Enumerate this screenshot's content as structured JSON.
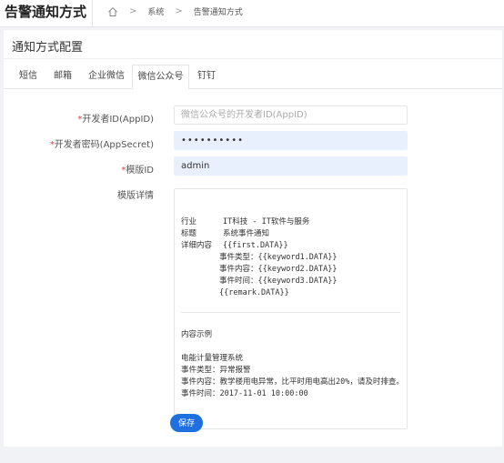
{
  "header": {
    "title": "告警通知方式",
    "breadcrumb": [
      "系统",
      "告警通知方式"
    ]
  },
  "card": {
    "title": "通知方式配置"
  },
  "tabs": [
    {
      "label": "短信",
      "active": false
    },
    {
      "label": "邮箱",
      "active": false
    },
    {
      "label": "企业微信",
      "active": false
    },
    {
      "label": "微信公众号",
      "active": true
    },
    {
      "label": "钉钉",
      "active": false
    }
  ],
  "form": {
    "appid": {
      "label": "开发者ID(AppID)",
      "required": true,
      "value": "",
      "placeholder": "微信公众号的开发者ID(AppID)"
    },
    "secret": {
      "label": "开发者密码(AppSecret)",
      "required": true,
      "value": "••••••••••"
    },
    "template_id": {
      "label": "模版ID",
      "required": true,
      "value": "admin"
    },
    "template_detail": {
      "label": "模版详情",
      "lines": [
        {
          "k": "行业",
          "v": "IT科技 - IT软件与服务"
        },
        {
          "k": "标题",
          "v": "系统事件通知"
        },
        {
          "k": "详细内容",
          "v": "{{first.DATA}}"
        },
        {
          "k": "",
          "v": "事件类型：{{keyword1.DATA}}"
        },
        {
          "k": "",
          "v": "事件内容：{{keyword2.DATA}}"
        },
        {
          "k": "",
          "v": "事件时间：{{keyword3.DATA}}"
        },
        {
          "k": "",
          "v": "{{remark.DATA}}"
        }
      ],
      "example_title": "内容示例",
      "example_lines": [
        "电能计量管理系统",
        "事件类型：异常报警",
        "事件内容：教学楼用电异常，比平时用电高出20%，请及时排查。",
        "事件时间：2017-11-01 10:00:00"
      ]
    }
  },
  "buttons": {
    "save": "保存"
  },
  "colors": {
    "primary": "#1e6fe0",
    "required": "#e4393c",
    "autofill": "#e8f0fe"
  }
}
